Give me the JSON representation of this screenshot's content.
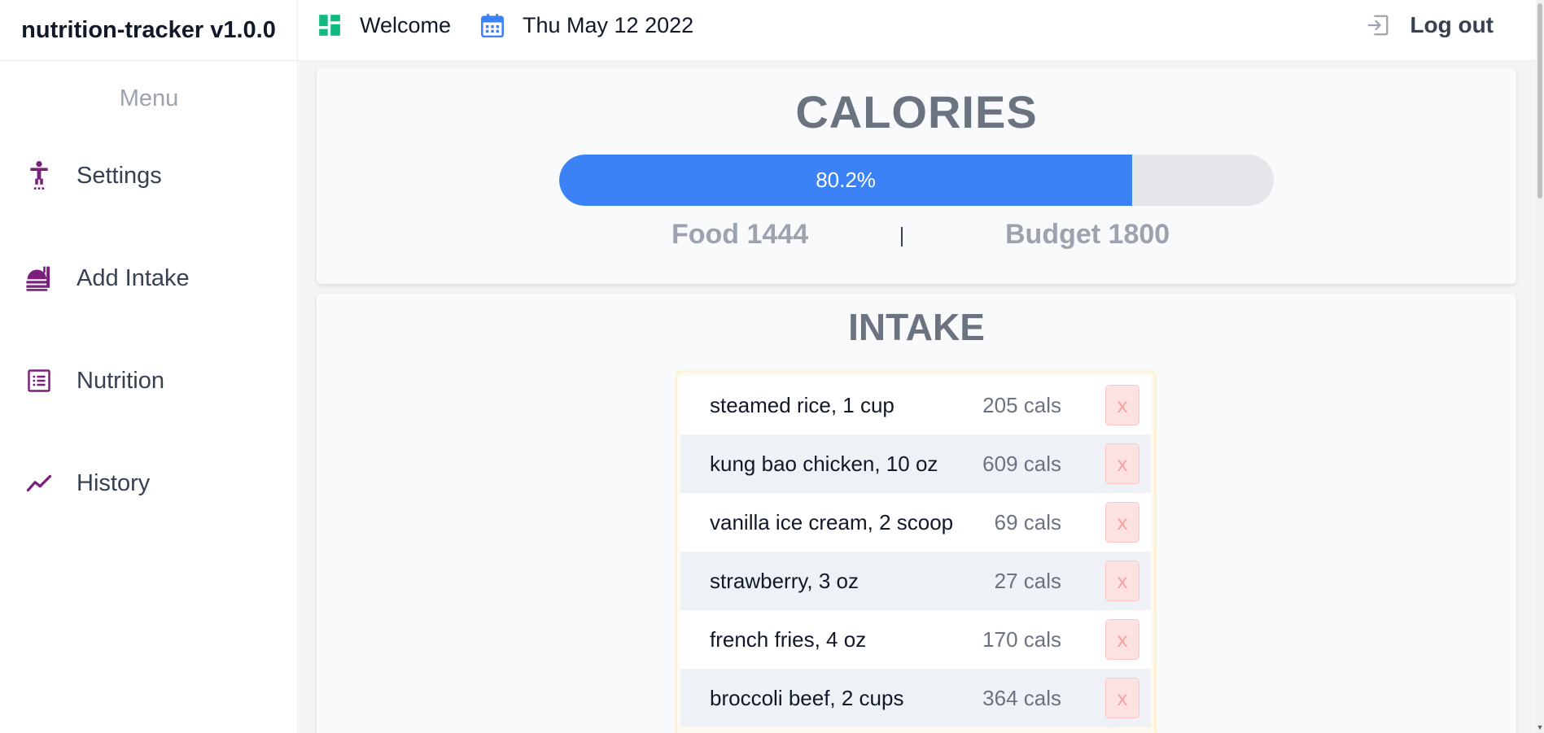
{
  "app": {
    "title": "nutrition-tracker v1.0.0"
  },
  "header": {
    "welcome": {
      "label": "Welcome",
      "icon": "dashboard-icon"
    },
    "date": {
      "label": "Thu May 12 2022",
      "icon": "calendar-icon"
    },
    "logout": {
      "label": "Log out",
      "icon": "logout-icon"
    }
  },
  "sidebar": {
    "title": "Menu",
    "items": [
      {
        "label": "Settings",
        "icon": "person-icon"
      },
      {
        "label": "Add Intake",
        "icon": "food-icon"
      },
      {
        "label": "Nutrition",
        "icon": "list-icon"
      },
      {
        "label": "History",
        "icon": "trend-icon"
      }
    ]
  },
  "calories": {
    "title": "CALORIES",
    "progress_label": "80.2%",
    "progress_fraction": 0.802,
    "food_label": "Food 1444",
    "budget_label": "Budget 1800"
  },
  "intake": {
    "title": "INTAKE",
    "delete_label": "x",
    "items": [
      {
        "name": "steamed rice, 1 cup",
        "cals": "205 cals"
      },
      {
        "name": "kung bao chicken, 10 oz",
        "cals": "609 cals"
      },
      {
        "name": "vanilla ice cream, 2 scoop",
        "cals": "69 cals"
      },
      {
        "name": "strawberry, 3 oz",
        "cals": "27 cals"
      },
      {
        "name": "french fries, 4 oz",
        "cals": "170 cals"
      },
      {
        "name": "broccoli beef, 2 cups",
        "cals": "364 cals"
      }
    ]
  },
  "colors": {
    "accent": "#3b82f6",
    "nav_icon": "#7b1f7d",
    "welcome_icon": "#10b981",
    "calendar_icon": "#3b82f6"
  }
}
